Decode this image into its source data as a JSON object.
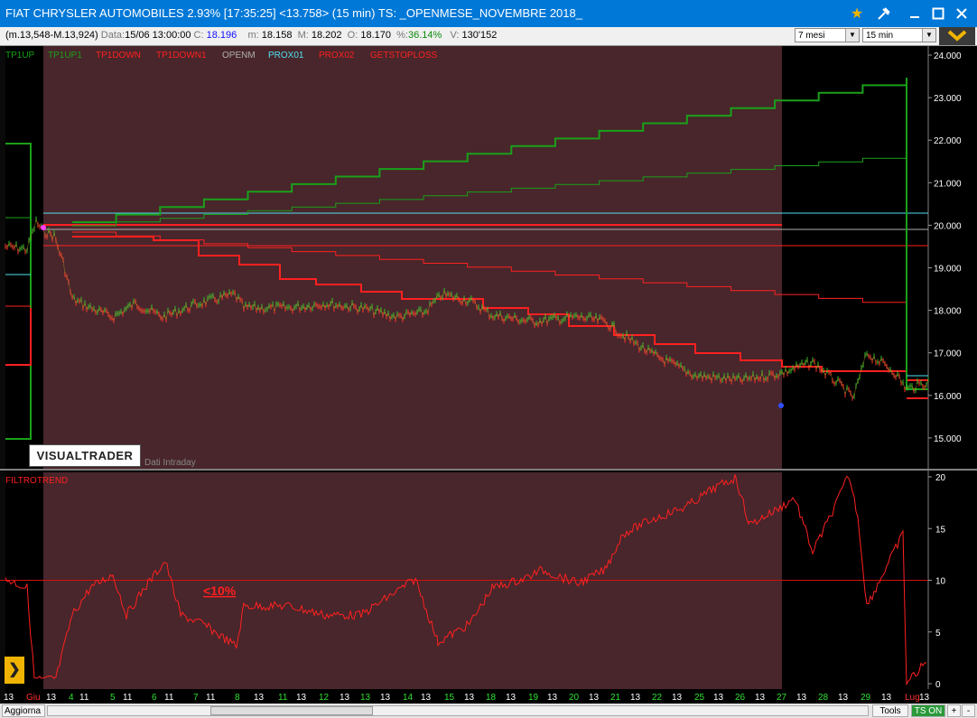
{
  "window": {
    "title": "FIAT CHRYSLER AUTOMOBILES 2.93% [17:35:25]  <13.758> (15 min) TS: _OPENMESE_NOVEMBRE 2018_"
  },
  "info": {
    "range": "(m.13,548-M.13,924)",
    "data_label": "Data:",
    "data_value": "15/06 13:00:00",
    "c_label": "C:",
    "c_value": "18.196",
    "m_label": "m:",
    "m_value": "18.158",
    "M_label": "M:",
    "M_value": "18.202",
    "o_label": "O:",
    "o_value": "18.170",
    "pct_label": "%:",
    "pct_value": "36.14%",
    "v_label": "V:",
    "v_value": "130'152"
  },
  "controls": {
    "period": "7 mesi",
    "timeframe": "15 min"
  },
  "legend": [
    {
      "label": "TP1UP",
      "color": "#1aa01a"
    },
    {
      "label": "TP1UP1",
      "color": "#1aa01a"
    },
    {
      "label": "TP1DOWN",
      "color": "#ff2020"
    },
    {
      "label": "TP1DOWN1",
      "color": "#ff2020"
    },
    {
      "label": "OPENM",
      "color": "#b0b0b0"
    },
    {
      "label": "PROX01",
      "color": "#50e0f0"
    },
    {
      "label": "PROX02",
      "color": "#ff2020"
    },
    {
      "label": "GETSTOPLOSS",
      "color": "#ff2020"
    }
  ],
  "price_axis": [
    "24.000",
    "23.000",
    "22.000",
    "21.000",
    "20.000",
    "19.000",
    "18.000",
    "17.000",
    "16.000",
    "15.000"
  ],
  "indicator": {
    "name": "FILTROTREND",
    "annotation": "<10%",
    "axis": [
      "20",
      "15",
      "10",
      "5",
      "0"
    ]
  },
  "x_labels": [
    {
      "t": "13",
      "c": "#ffffff"
    },
    {
      "t": "Giu",
      "c": "#ff3030"
    },
    {
      "t": "13",
      "c": "#ffffff"
    },
    {
      "t": "4",
      "c": "#30e030"
    },
    {
      "t": "11",
      "c": "#ffffff"
    },
    {
      "t": "5",
      "c": "#30e030"
    },
    {
      "t": "11",
      "c": "#ffffff"
    },
    {
      "t": "6",
      "c": "#30e030"
    },
    {
      "t": "11",
      "c": "#ffffff"
    },
    {
      "t": "7",
      "c": "#30e030"
    },
    {
      "t": "11",
      "c": "#ffffff"
    },
    {
      "t": "8",
      "c": "#30e030"
    },
    {
      "t": "13",
      "c": "#ffffff"
    },
    {
      "t": "11",
      "c": "#30e030"
    },
    {
      "t": "13",
      "c": "#ffffff"
    },
    {
      "t": "12",
      "c": "#30e030"
    },
    {
      "t": "13",
      "c": "#ffffff"
    },
    {
      "t": "13",
      "c": "#30e030"
    },
    {
      "t": "13",
      "c": "#ffffff"
    },
    {
      "t": "14",
      "c": "#30e030"
    },
    {
      "t": "13",
      "c": "#ffffff"
    },
    {
      "t": "15",
      "c": "#30e030"
    },
    {
      "t": "13",
      "c": "#ffffff"
    },
    {
      "t": "18",
      "c": "#30e030"
    },
    {
      "t": "13",
      "c": "#ffffff"
    },
    {
      "t": "19",
      "c": "#30e030"
    },
    {
      "t": "13",
      "c": "#ffffff"
    },
    {
      "t": "20",
      "c": "#30e030"
    },
    {
      "t": "13",
      "c": "#ffffff"
    },
    {
      "t": "21",
      "c": "#30e030"
    },
    {
      "t": "13",
      "c": "#ffffff"
    },
    {
      "t": "22",
      "c": "#30e030"
    },
    {
      "t": "13",
      "c": "#ffffff"
    },
    {
      "t": "25",
      "c": "#30e030"
    },
    {
      "t": "13",
      "c": "#ffffff"
    },
    {
      "t": "26",
      "c": "#30e030"
    },
    {
      "t": "13",
      "c": "#ffffff"
    },
    {
      "t": "27",
      "c": "#30e030"
    },
    {
      "t": "13",
      "c": "#ffffff"
    },
    {
      "t": "28",
      "c": "#30e030"
    },
    {
      "t": "13",
      "c": "#ffffff"
    },
    {
      "t": "29",
      "c": "#30e030"
    },
    {
      "t": "13",
      "c": "#ffffff"
    },
    {
      "t": "Lug",
      "c": "#ff3030"
    },
    {
      "t": "13",
      "c": "#ffffff"
    }
  ],
  "logo_text": "VISUALTRADER",
  "data_source": "Dati Intraday",
  "bottom": {
    "refresh": "Aggiorna",
    "tools": "Tools",
    "ts_on": "TS ON",
    "plus": "+",
    "minus": "-"
  },
  "colors": {
    "titlebar": "#0078d7",
    "highlight": "#48262b",
    "accent": "#f0b400"
  }
}
